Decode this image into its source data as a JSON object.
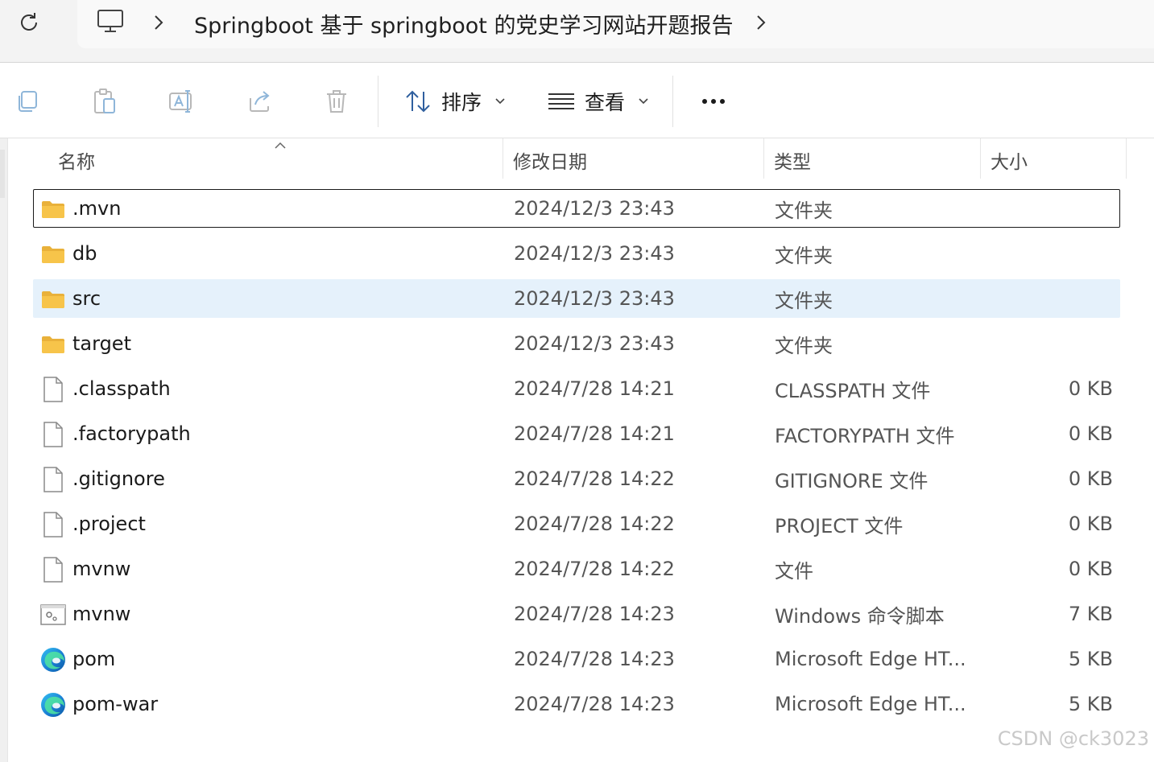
{
  "addressbar": {
    "breadcrumb_title": "Springboot 基于 springboot 的党史学习网站开题报告"
  },
  "toolbar": {
    "sort_label": "排序",
    "view_label": "查看"
  },
  "columns": {
    "name": "名称",
    "date": "修改日期",
    "type": "类型",
    "size": "大小"
  },
  "files": [
    {
      "name": ".mvn",
      "date": "2024/12/3 23:43",
      "type": "文件夹",
      "size": "",
      "icon": "folder-icon"
    },
    {
      "name": "db",
      "date": "2024/12/3 23:43",
      "type": "文件夹",
      "size": "",
      "icon": "folder-icon"
    },
    {
      "name": "src",
      "date": "2024/12/3 23:43",
      "type": "文件夹",
      "size": "",
      "icon": "folder-icon"
    },
    {
      "name": "target",
      "date": "2024/12/3 23:43",
      "type": "文件夹",
      "size": "",
      "icon": "folder-icon"
    },
    {
      "name": ".classpath",
      "date": "2024/7/28 14:21",
      "type": "CLASSPATH 文件",
      "size": "0 KB",
      "icon": "file-icon"
    },
    {
      "name": ".factorypath",
      "date": "2024/7/28 14:21",
      "type": "FACTORYPATH 文件",
      "size": "0 KB",
      "icon": "file-icon"
    },
    {
      "name": ".gitignore",
      "date": "2024/7/28 14:22",
      "type": "GITIGNORE 文件",
      "size": "0 KB",
      "icon": "file-icon"
    },
    {
      "name": ".project",
      "date": "2024/7/28 14:22",
      "type": "PROJECT 文件",
      "size": "0 KB",
      "icon": "file-icon"
    },
    {
      "name": "mvnw",
      "date": "2024/7/28 14:22",
      "type": "文件",
      "size": "0 KB",
      "icon": "file-icon"
    },
    {
      "name": "mvnw",
      "date": "2024/7/28 14:23",
      "type": "Windows 命令脚本",
      "size": "7 KB",
      "icon": "script-icon"
    },
    {
      "name": "pom",
      "date": "2024/7/28 14:23",
      "type": "Microsoft Edge HT...",
      "size": "5 KB",
      "icon": "edge-icon"
    },
    {
      "name": "pom-war",
      "date": "2024/7/28 14:23",
      "type": "Microsoft Edge HT...",
      "size": "5 KB",
      "icon": "edge-icon"
    }
  ],
  "state": {
    "focused_row": 0,
    "selected_row": 2
  },
  "watermark": "CSDN @ck3023",
  "colors": {
    "selection": "#e5f1fb",
    "folder": "#f7c44a"
  }
}
